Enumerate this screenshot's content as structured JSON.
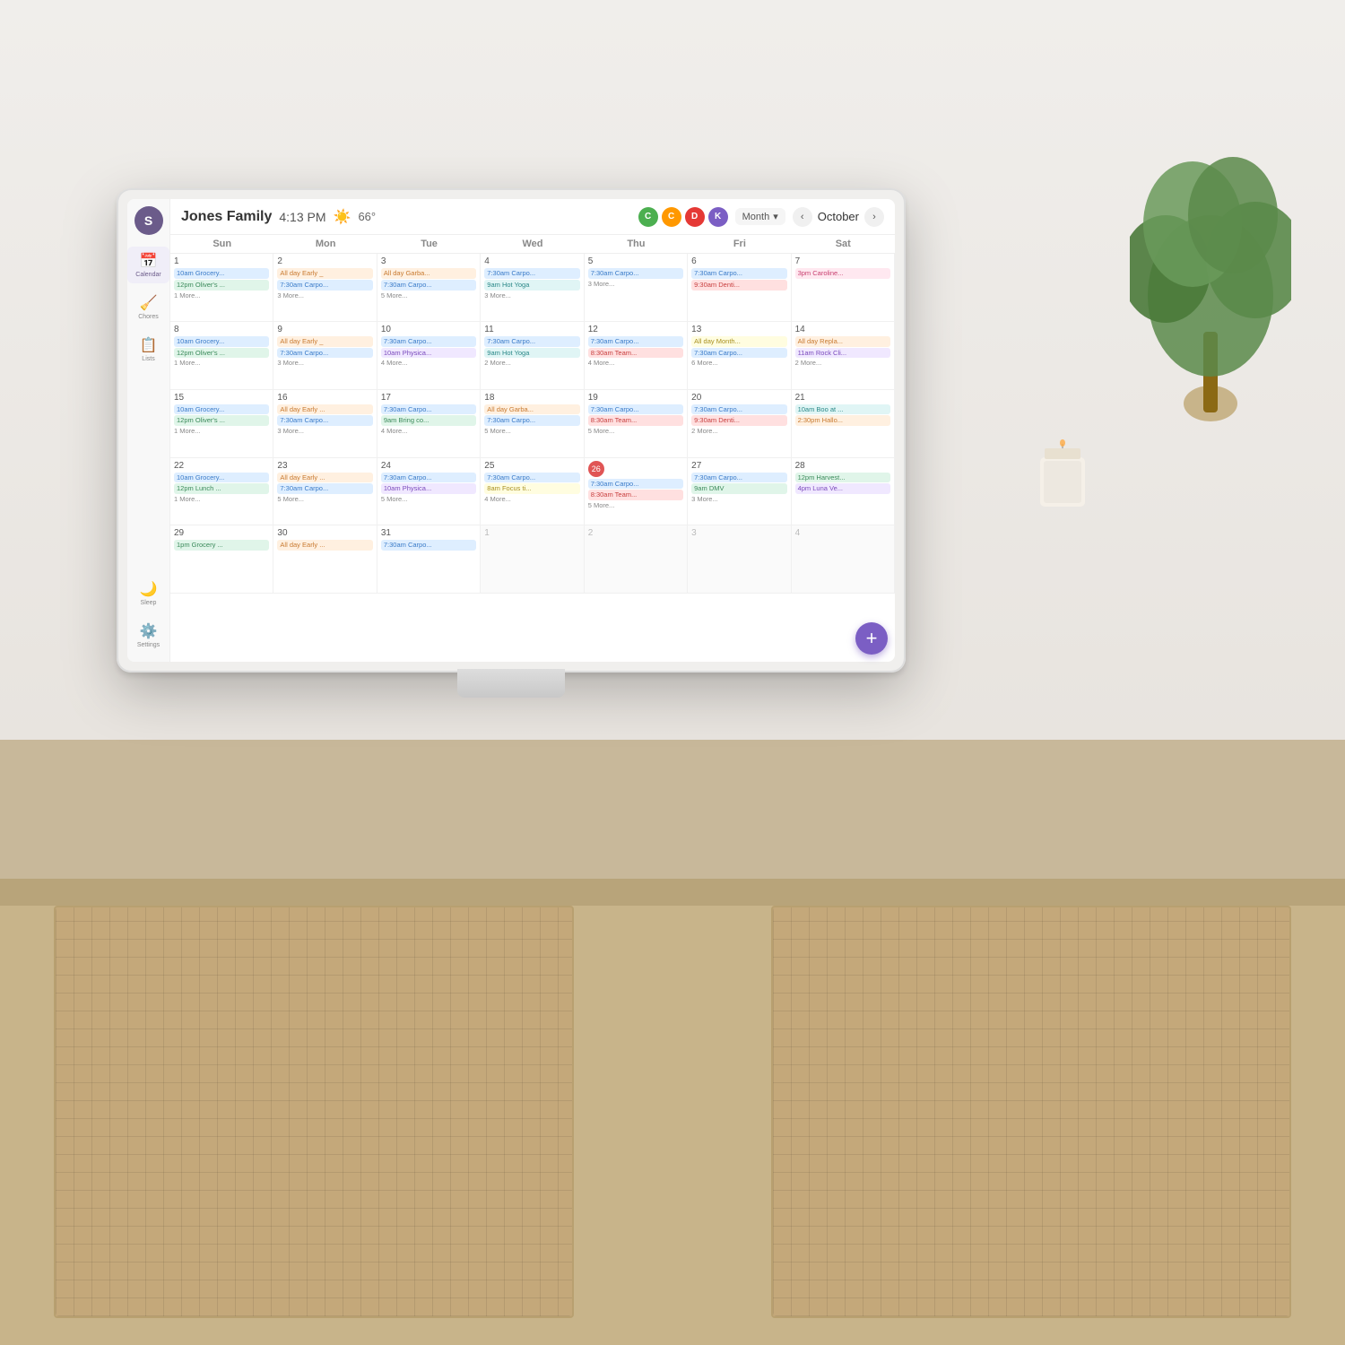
{
  "room": {
    "bg_color": "#e8e4df"
  },
  "device": {
    "title": "Jones Family",
    "time": "4:13 PM",
    "weather_icon": "☀️",
    "temperature": "66°"
  },
  "sidebar": {
    "initial": "S",
    "items": [
      {
        "id": "calendar",
        "label": "Calendar",
        "icon": "📅",
        "active": true
      },
      {
        "id": "chores",
        "label": "Chores",
        "icon": "🧹",
        "active": false
      },
      {
        "id": "lists",
        "label": "Lists",
        "icon": "📋",
        "active": false
      },
      {
        "id": "sleep",
        "label": "Sleep",
        "icon": "🌙",
        "active": false
      },
      {
        "id": "settings",
        "label": "Settings",
        "icon": "⚙️",
        "active": false
      }
    ]
  },
  "header": {
    "avatars": [
      {
        "id": "C1",
        "label": "C",
        "color": "#4caf50"
      },
      {
        "id": "C2",
        "label": "C",
        "color": "#ff9800"
      },
      {
        "id": "D",
        "label": "D",
        "color": "#e53935"
      },
      {
        "id": "K",
        "label": "K",
        "color": "#7b5ec4"
      }
    ],
    "view": "Month",
    "month": "October",
    "nav_prev": "‹",
    "nav_next": "›"
  },
  "calendar": {
    "days": [
      "Sun",
      "Mon",
      "Tue",
      "Wed",
      "Thu",
      "Fri",
      "Sat"
    ],
    "weeks": [
      {
        "cells": [
          {
            "date": "1",
            "other": false,
            "today": false,
            "events": [
              {
                "type": "blue",
                "text": "10am Grocery..."
              },
              {
                "type": "green",
                "text": "12pm Oliver's ..."
              }
            ],
            "more": "1 More..."
          },
          {
            "date": "2",
            "other": false,
            "today": false,
            "events": [
              {
                "type": "orange",
                "text": "All day Early _"
              },
              {
                "type": "blue",
                "text": "7:30am Carpo..."
              }
            ],
            "more": "3 More..."
          },
          {
            "date": "3",
            "other": false,
            "today": false,
            "events": [
              {
                "type": "orange",
                "text": "All day Garba..."
              },
              {
                "type": "blue",
                "text": "7:30am Carpo..."
              }
            ],
            "more": "5 More..."
          },
          {
            "date": "4",
            "other": false,
            "today": false,
            "events": [
              {
                "type": "blue",
                "text": "7:30am Carpo..."
              },
              {
                "type": "teal",
                "text": "9am Hot Yoga"
              }
            ],
            "more": "3 More..."
          },
          {
            "date": "5",
            "other": false,
            "today": false,
            "events": [
              {
                "type": "blue",
                "text": "7:30am Carpo..."
              }
            ],
            "more": "3 More..."
          },
          {
            "date": "6",
            "other": false,
            "today": false,
            "events": [
              {
                "type": "blue",
                "text": "7:30am Carpo..."
              },
              {
                "type": "red",
                "text": "9:30am Denti..."
              }
            ],
            "more": ""
          },
          {
            "date": "7",
            "other": false,
            "today": false,
            "events": [
              {
                "type": "pink",
                "text": "3pm Caroline..."
              }
            ],
            "more": ""
          }
        ]
      },
      {
        "cells": [
          {
            "date": "8",
            "other": false,
            "today": false,
            "events": [
              {
                "type": "blue",
                "text": "10am Grocery..."
              },
              {
                "type": "green",
                "text": "12pm Oliver's ..."
              }
            ],
            "more": "1 More..."
          },
          {
            "date": "9",
            "other": false,
            "today": false,
            "events": [
              {
                "type": "orange",
                "text": "All day Early _"
              },
              {
                "type": "blue",
                "text": "7:30am Carpo..."
              }
            ],
            "more": "3 More..."
          },
          {
            "date": "10",
            "other": false,
            "today": false,
            "events": [
              {
                "type": "blue",
                "text": "7:30am Carpo..."
              },
              {
                "type": "purple",
                "text": "10am Physica..."
              }
            ],
            "more": "4 More..."
          },
          {
            "date": "11",
            "other": false,
            "today": false,
            "events": [
              {
                "type": "blue",
                "text": "7:30am Carpo..."
              },
              {
                "type": "teal",
                "text": "9am Hot Yoga"
              }
            ],
            "more": "2 More..."
          },
          {
            "date": "12",
            "other": false,
            "today": false,
            "events": [
              {
                "type": "blue",
                "text": "7:30am Carpo..."
              },
              {
                "type": "red",
                "text": "8:30am Team..."
              }
            ],
            "more": "4 More..."
          },
          {
            "date": "13",
            "other": false,
            "today": false,
            "events": [
              {
                "type": "yellow",
                "text": "All day Month..."
              },
              {
                "type": "blue",
                "text": "7:30am Carpo..."
              }
            ],
            "more": "6 More..."
          },
          {
            "date": "14",
            "other": false,
            "today": false,
            "events": [
              {
                "type": "orange",
                "text": "All day Repla..."
              },
              {
                "type": "purple",
                "text": "11am Rock Cli..."
              }
            ],
            "more": "2 More..."
          }
        ]
      },
      {
        "cells": [
          {
            "date": "15",
            "other": false,
            "today": false,
            "events": [
              {
                "type": "blue",
                "text": "10am Grocery..."
              },
              {
                "type": "green",
                "text": "12pm Oliver's ..."
              }
            ],
            "more": "1 More..."
          },
          {
            "date": "16",
            "other": false,
            "today": false,
            "events": [
              {
                "type": "orange",
                "text": "All day Early ..."
              },
              {
                "type": "blue",
                "text": "7:30am Carpo..."
              }
            ],
            "more": "3 More..."
          },
          {
            "date": "17",
            "other": false,
            "today": false,
            "events": [
              {
                "type": "blue",
                "text": "7:30am Carpo..."
              },
              {
                "type": "green",
                "text": "9am Bring co..."
              }
            ],
            "more": "4 More..."
          },
          {
            "date": "18",
            "other": false,
            "today": false,
            "events": [
              {
                "type": "orange",
                "text": "All day Garba..."
              },
              {
                "type": "blue",
                "text": "7:30am Carpo..."
              }
            ],
            "more": "5 More..."
          },
          {
            "date": "19",
            "other": false,
            "today": false,
            "events": [
              {
                "type": "blue",
                "text": "7:30am Carpo..."
              },
              {
                "type": "red",
                "text": "8:30am Team..."
              }
            ],
            "more": "5 More..."
          },
          {
            "date": "20",
            "other": false,
            "today": false,
            "events": [
              {
                "type": "blue",
                "text": "7:30am Carpo..."
              },
              {
                "type": "red",
                "text": "9:30am Denti..."
              }
            ],
            "more": "2 More..."
          },
          {
            "date": "21",
            "other": false,
            "today": false,
            "events": [
              {
                "type": "teal",
                "text": "10am Boo at ..."
              },
              {
                "type": "orange",
                "text": "2:30pm Hallo..."
              }
            ],
            "more": ""
          }
        ]
      },
      {
        "cells": [
          {
            "date": "22",
            "other": false,
            "today": false,
            "events": [
              {
                "type": "blue",
                "text": "10am Grocery..."
              },
              {
                "type": "green",
                "text": "12pm Lunch ..."
              }
            ],
            "more": "1 More..."
          },
          {
            "date": "23",
            "other": false,
            "today": false,
            "events": [
              {
                "type": "orange",
                "text": "All day Early ..."
              },
              {
                "type": "blue",
                "text": "7:30am Carpo..."
              }
            ],
            "more": "5 More..."
          },
          {
            "date": "24",
            "other": false,
            "today": false,
            "events": [
              {
                "type": "blue",
                "text": "7:30am Carpo..."
              },
              {
                "type": "purple",
                "text": "10am Physica..."
              }
            ],
            "more": "5 More..."
          },
          {
            "date": "25",
            "other": false,
            "today": false,
            "events": [
              {
                "type": "blue",
                "text": "7:30am Carpo..."
              },
              {
                "type": "yellow",
                "text": "8am Focus ti..."
              }
            ],
            "more": "4 More..."
          },
          {
            "date": "26",
            "other": false,
            "today": true,
            "events": [
              {
                "type": "blue",
                "text": "7:30am Carpo..."
              },
              {
                "type": "red",
                "text": "8:30am Team..."
              }
            ],
            "more": "5 More..."
          },
          {
            "date": "27",
            "other": false,
            "today": false,
            "events": [
              {
                "type": "blue",
                "text": "7:30am Carpo..."
              },
              {
                "type": "green",
                "text": "9am DMV"
              }
            ],
            "more": "3 More..."
          },
          {
            "date": "28",
            "other": false,
            "today": false,
            "events": [
              {
                "type": "green",
                "text": "12pm Harvest..."
              },
              {
                "type": "purple",
                "text": "4pm Luna Ve..."
              }
            ],
            "more": ""
          }
        ]
      },
      {
        "cells": [
          {
            "date": "29",
            "other": false,
            "today": false,
            "events": [
              {
                "type": "green",
                "text": "1pm Grocery ..."
              }
            ],
            "more": ""
          },
          {
            "date": "30",
            "other": false,
            "today": false,
            "events": [
              {
                "type": "orange",
                "text": "All day Early ..."
              }
            ],
            "more": ""
          },
          {
            "date": "31",
            "other": false,
            "today": false,
            "events": [
              {
                "type": "blue",
                "text": "7:30am Carpo..."
              }
            ],
            "more": ""
          },
          {
            "date": "1",
            "other": true,
            "today": false,
            "events": [],
            "more": ""
          },
          {
            "date": "2",
            "other": true,
            "today": false,
            "events": [],
            "more": ""
          },
          {
            "date": "3",
            "other": true,
            "today": false,
            "events": [],
            "more": ""
          },
          {
            "date": "4",
            "other": true,
            "today": false,
            "events": [],
            "more": ""
          }
        ]
      }
    ]
  },
  "fab": {
    "label": "+"
  }
}
